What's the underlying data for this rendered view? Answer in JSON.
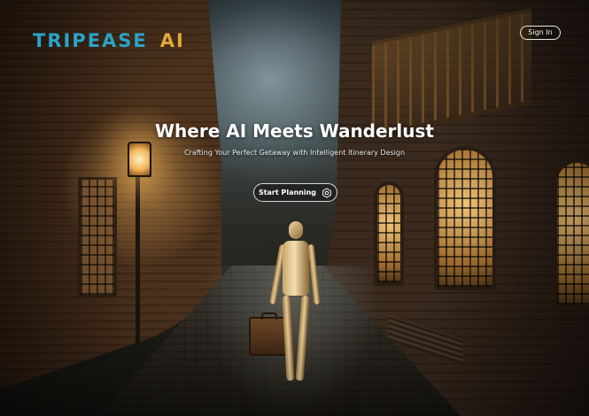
{
  "brand": {
    "name": "TRIPEASE",
    "suffix": "AI",
    "primary_color": "#2aa3c6",
    "accent_color": "#e2a93a"
  },
  "header": {
    "sign_in_label": "Sign In"
  },
  "hero": {
    "headline": "Where AI Meets Wanderlust",
    "subheadline": "Crafting Your Perfect Getaway with Intelligent Itinerary Design",
    "cta_label": "Start Planning",
    "cta_icon": "gear-icon"
  }
}
